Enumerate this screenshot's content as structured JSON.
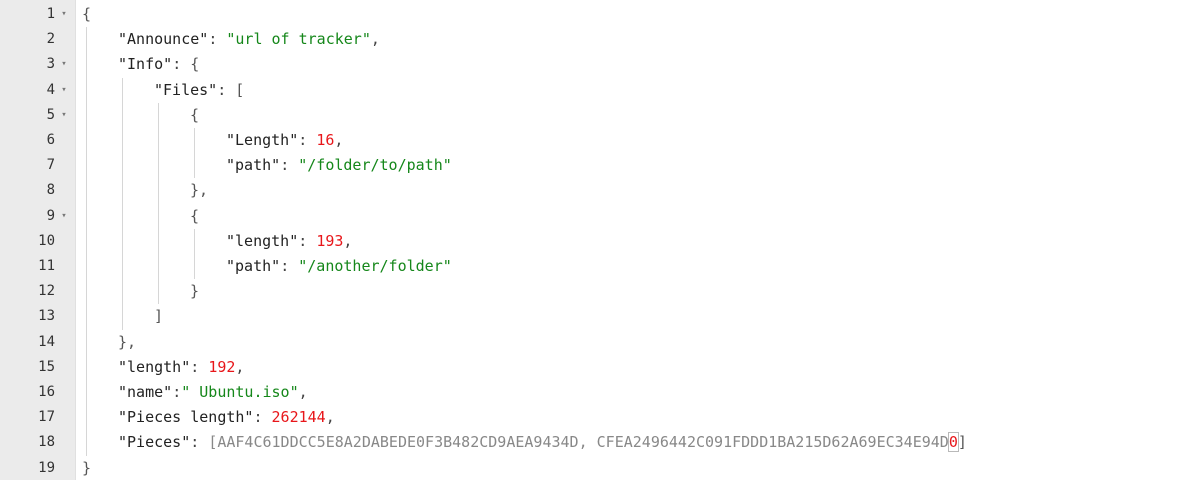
{
  "lines": [
    {
      "no": "1",
      "fold": "▾",
      "parts": [
        {
          "t": "{",
          "c": "br"
        }
      ]
    },
    {
      "no": "2",
      "fold": "",
      "parts": [
        {
          "t": "\"Announce\"",
          "c": "k"
        },
        {
          "t": ": ",
          "c": "p"
        },
        {
          "t": "\"url of tracker\"",
          "c": "s"
        },
        {
          "t": ",",
          "c": "p"
        }
      ]
    },
    {
      "no": "3",
      "fold": "▾",
      "parts": [
        {
          "t": "\"Info\"",
          "c": "k"
        },
        {
          "t": ": ",
          "c": "p"
        },
        {
          "t": "{",
          "c": "br"
        }
      ]
    },
    {
      "no": "4",
      "fold": "▾",
      "parts": [
        {
          "t": "\"Files\"",
          "c": "k"
        },
        {
          "t": ": ",
          "c": "p"
        },
        {
          "t": "[",
          "c": "br"
        }
      ]
    },
    {
      "no": "5",
      "fold": "▾",
      "parts": [
        {
          "t": "{",
          "c": "br"
        }
      ]
    },
    {
      "no": "6",
      "fold": "",
      "parts": [
        {
          "t": "\"Length\"",
          "c": "k"
        },
        {
          "t": ": ",
          "c": "p"
        },
        {
          "t": "16",
          "c": "n"
        },
        {
          "t": ",",
          "c": "p"
        }
      ]
    },
    {
      "no": "7",
      "fold": "",
      "parts": [
        {
          "t": "\"path\"",
          "c": "k"
        },
        {
          "t": ": ",
          "c": "p"
        },
        {
          "t": "\"/folder/to/path\"",
          "c": "s"
        }
      ]
    },
    {
      "no": "8",
      "fold": "",
      "parts": [
        {
          "t": "},",
          "c": "br"
        }
      ]
    },
    {
      "no": "9",
      "fold": "▾",
      "parts": [
        {
          "t": "{",
          "c": "br"
        }
      ]
    },
    {
      "no": "10",
      "fold": "",
      "parts": [
        {
          "t": "\"length\"",
          "c": "k"
        },
        {
          "t": ": ",
          "c": "p"
        },
        {
          "t": "193",
          "c": "n"
        },
        {
          "t": ",",
          "c": "p"
        }
      ]
    },
    {
      "no": "11",
      "fold": "",
      "parts": [
        {
          "t": "\"path\"",
          "c": "k"
        },
        {
          "t": ": ",
          "c": "p"
        },
        {
          "t": "\"/another/folder\"",
          "c": "s"
        }
      ]
    },
    {
      "no": "12",
      "fold": "",
      "parts": [
        {
          "t": "}",
          "c": "br"
        }
      ]
    },
    {
      "no": "13",
      "fold": "",
      "parts": [
        {
          "t": "]",
          "c": "br"
        }
      ]
    },
    {
      "no": "14",
      "fold": "",
      "parts": [
        {
          "t": "},",
          "c": "br"
        }
      ]
    },
    {
      "no": "15",
      "fold": "",
      "parts": [
        {
          "t": "\"length\"",
          "c": "k"
        },
        {
          "t": ": ",
          "c": "p"
        },
        {
          "t": "192",
          "c": "n"
        },
        {
          "t": ",",
          "c": "p"
        }
      ]
    },
    {
      "no": "16",
      "fold": "",
      "parts": [
        {
          "t": "\"name\"",
          "c": "k"
        },
        {
          "t": ":",
          "c": "p"
        },
        {
          "t": "\" Ubuntu.iso\"",
          "c": "s"
        },
        {
          "t": ",",
          "c": "p"
        }
      ]
    },
    {
      "no": "17",
      "fold": "",
      "parts": [
        {
          "t": "\"Pieces length\"",
          "c": "k"
        },
        {
          "t": ": ",
          "c": "p"
        },
        {
          "t": "262144",
          "c": "n"
        },
        {
          "t": ",",
          "c": "p"
        }
      ]
    },
    {
      "no": "18",
      "fold": "",
      "parts": [
        {
          "t": "\"Pieces\"",
          "c": "k"
        },
        {
          "t": ": ",
          "c": "p"
        },
        {
          "t": "[AAF4C61DDCC5E8A2DABEDE0F3B482CD9AEA9434D, CFEA2496442C091FDDD1BA215D62A69EC34E94D",
          "c": "pieces-val"
        },
        {
          "t": "0",
          "c": "hl"
        },
        {
          "t": "]",
          "c": "br"
        }
      ]
    },
    {
      "no": "19",
      "fold": "",
      "parts": [
        {
          "t": "}",
          "c": "br"
        }
      ]
    }
  ],
  "colors": {
    "key": "#222222",
    "string": "#15871a",
    "number": "#e8161a",
    "pieces": "#888888",
    "gutter": "#ebebeb"
  }
}
